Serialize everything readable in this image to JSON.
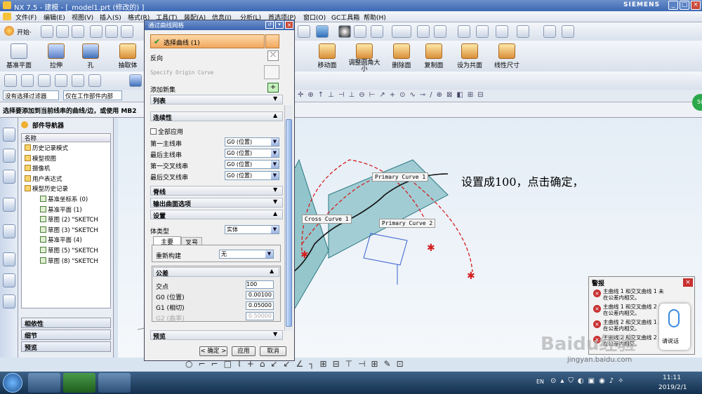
{
  "window": {
    "title": "NX 7.5 - 建模 - [_model1.prt (修改的) ]",
    "brand": "SIEMENS"
  },
  "menubar": [
    "文件(F)",
    "编辑(E)",
    "视图(V)",
    "插入(S)",
    "格式(R)",
    "工具(T)",
    "装配(A)",
    "信息(I)",
    "分析(L)",
    "首选项(P)",
    "窗口(O)",
    "GC工具箱",
    "帮助(H)"
  ],
  "toolbar": {
    "start_label": "开始·"
  },
  "feature_toolbar": {
    "left": [
      "基准平面",
      "拉伸",
      "孔",
      "抽取体"
    ],
    "right": [
      "移动面",
      "调整圆角大小",
      "删除面",
      "复制面",
      "设为共面",
      "线性尺寸"
    ]
  },
  "filter_bar": {
    "filter_value": "没有选择过滤器",
    "scope_value": "仅在工作部件内部"
  },
  "cue_line": "选择要添加到当前线串的曲线/边，或使用 MB2",
  "navigator": {
    "title": "部件导航器",
    "column_header": "名称",
    "items": [
      {
        "label": "历史记录模式",
        "indent": 0
      },
      {
        "label": "模型视图",
        "indent": 0
      },
      {
        "label": "摄像机",
        "indent": 0
      },
      {
        "label": "用户表达式",
        "indent": 0
      },
      {
        "label": "模型历史记录",
        "indent": 0
      },
      {
        "label": "基准坐标系 (0)",
        "indent": 1
      },
      {
        "label": "基准平面 (1)",
        "indent": 1
      },
      {
        "label": "草图 (2) \"SKETCH",
        "indent": 1
      },
      {
        "label": "草图 (3) \"SKETCH",
        "indent": 1
      },
      {
        "label": "基准平面 (4)",
        "indent": 1
      },
      {
        "label": "草图 (5) \"SKETCH",
        "indent": 1
      },
      {
        "label": "草图 (8) \"SKETCH",
        "indent": 1
      }
    ],
    "sections": [
      "相依性",
      "细节",
      "预览"
    ]
  },
  "dialog": {
    "title": "通过曲线网格",
    "select_curve": "选择曲线 (1)",
    "reverse": "反向",
    "specify_origin": "Specify Origin Curve",
    "add_new_set": "添加新集",
    "list": "列表",
    "continuity_header": "连续性",
    "apply_all": "全部应用",
    "continuity_rows": [
      {
        "label": "第一主线串",
        "value": "G0 (位置)"
      },
      {
        "label": "最后主线串",
        "value": "G0 (位置)"
      },
      {
        "label": "第一交叉线串",
        "value": "G0 (位置)"
      },
      {
        "label": "最后交叉线串",
        "value": "G0 (位置)"
      }
    ],
    "spine_header": "脊线",
    "output_header": "输出曲面选项",
    "settings_header": "设置",
    "body_type_label": "体类型",
    "body_type_value": "实体",
    "tab_primary": "主要",
    "tab_cross": "叉号",
    "rebuild_label": "重新构建",
    "rebuild_value": "无",
    "tolerance_header": "公差",
    "tolerance_rows": [
      {
        "label": "交点",
        "value": "100"
      },
      {
        "label": "G0 (位置)",
        "value": "0.00100"
      },
      {
        "label": "G1 (相切)",
        "value": "0.05000"
      },
      {
        "label": "G2 (曲率)",
        "value": "0.50000"
      }
    ],
    "preview_header": "预览",
    "ok": "< 确定 >",
    "apply": "应用",
    "cancel": "取消"
  },
  "viewport": {
    "labels": [
      "Primary Curve  1",
      "Cross Curve  1",
      "Primary Curve  2"
    ],
    "annotation": "设置成100，点击确定，",
    "selection_badge": "50"
  },
  "alert": {
    "title": "警报",
    "items": [
      "主曲线 1 和交叉曲线 1 未在公差内相交。",
      "主曲线 1 和交叉曲线 2 未在公差内相交。",
      "主曲线 2 和交叉曲线 1 未在公差内相交。",
      "主曲线 2 和交叉曲线 2 未在公差内相交。"
    ],
    "voice_label": "请说话"
  },
  "watermark": {
    "logo": "Baidu经验",
    "url": "jingyan.baidu.com"
  },
  "taskbar": {
    "lang": "EN",
    "time": "11:11",
    "date": "2019/2/1"
  },
  "colors": {
    "accent": "#3c66b1",
    "curve_red": "#d42020",
    "plane_teal": "#4aa0a8"
  }
}
